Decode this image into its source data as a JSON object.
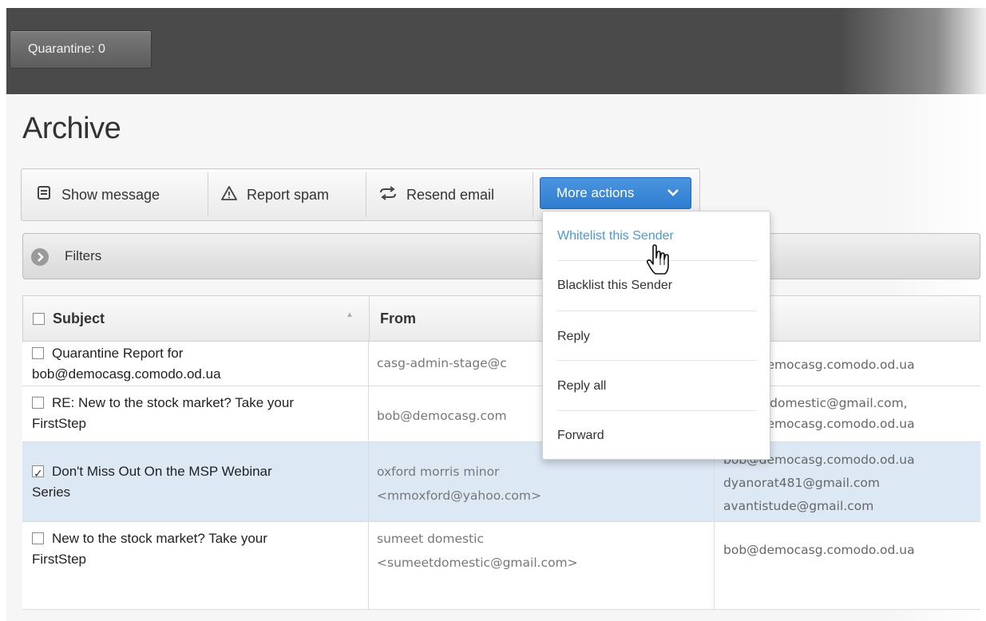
{
  "header": {
    "quarantine_label": "Quarantine: 0"
  },
  "page": {
    "title": "Archive"
  },
  "toolbar": {
    "show_message": "Show message",
    "report_spam": "Report spam",
    "resend_email": "Resend email",
    "more_actions": "More actions",
    "more_actions_color": "#3a88d8"
  },
  "filters": {
    "label": "Filters"
  },
  "table": {
    "columns": [
      "Subject",
      "From"
    ],
    "rows": [
      {
        "subject": [
          "Quarantine Report for",
          "bob@democasg.comodo.od.ua"
        ],
        "from": [
          "casg-admin-stage@c"
        ],
        "to": [
          "bob@democasg.comodo.od.ua"
        ],
        "checked": false
      },
      {
        "subject": [
          "RE: New to the stock market? Take your",
          "FirstStep"
        ],
        "from": [
          "bob@democasg.com"
        ],
        "to": [
          "sumeetdomestic@gmail.com,",
          "bob@democasg.comodo.od.ua"
        ],
        "checked": false
      },
      {
        "subject": [
          "Don't Miss Out On the MSP Webinar",
          "Series"
        ],
        "from": [
          "oxford morris minor",
          "<mmoxford@yahoo.com>"
        ],
        "to": [
          "bob@democasg.comodo.od.ua",
          "dyanorat481@gmail.com",
          "avantistude@gmail.com"
        ],
        "checked": true
      },
      {
        "subject": [
          "New to the stock market? Take your",
          "FirstStep"
        ],
        "from": [
          "sumeet domestic",
          "<sumeetdomestic@gmail.com>"
        ],
        "to": [
          "bob@democasg.comodo.od.ua"
        ],
        "checked": false
      }
    ]
  },
  "dropdown": {
    "items": [
      "Whitelist this Sender",
      "Blacklist this Sender",
      "Reply",
      "Reply all",
      "Forward"
    ],
    "hover_color": "#4a9ad4"
  },
  "icons": [
    "message-icon",
    "warning-icon",
    "resend-icon",
    "chevron-down-icon",
    "chevron-right-icon",
    "hand-cursor-icon"
  ]
}
